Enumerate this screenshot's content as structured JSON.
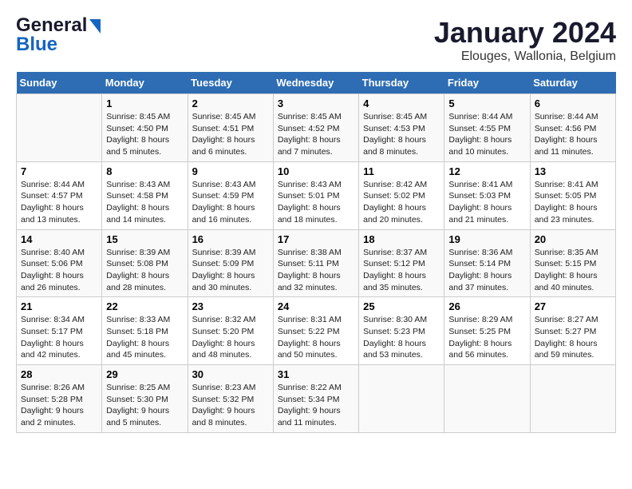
{
  "logo": {
    "general": "General",
    "blue": "Blue"
  },
  "title": "January 2024",
  "subtitle": "Elouges, Wallonia, Belgium",
  "days_of_week": [
    "Sunday",
    "Monday",
    "Tuesday",
    "Wednesday",
    "Thursday",
    "Friday",
    "Saturday"
  ],
  "weeks": [
    [
      {
        "day": "",
        "sunrise": "",
        "sunset": "",
        "daylight": ""
      },
      {
        "day": "1",
        "sunrise": "Sunrise: 8:45 AM",
        "sunset": "Sunset: 4:50 PM",
        "daylight": "Daylight: 8 hours and 5 minutes."
      },
      {
        "day": "2",
        "sunrise": "Sunrise: 8:45 AM",
        "sunset": "Sunset: 4:51 PM",
        "daylight": "Daylight: 8 hours and 6 minutes."
      },
      {
        "day": "3",
        "sunrise": "Sunrise: 8:45 AM",
        "sunset": "Sunset: 4:52 PM",
        "daylight": "Daylight: 8 hours and 7 minutes."
      },
      {
        "day": "4",
        "sunrise": "Sunrise: 8:45 AM",
        "sunset": "Sunset: 4:53 PM",
        "daylight": "Daylight: 8 hours and 8 minutes."
      },
      {
        "day": "5",
        "sunrise": "Sunrise: 8:44 AM",
        "sunset": "Sunset: 4:55 PM",
        "daylight": "Daylight: 8 hours and 10 minutes."
      },
      {
        "day": "6",
        "sunrise": "Sunrise: 8:44 AM",
        "sunset": "Sunset: 4:56 PM",
        "daylight": "Daylight: 8 hours and 11 minutes."
      }
    ],
    [
      {
        "day": "7",
        "sunrise": "Sunrise: 8:44 AM",
        "sunset": "Sunset: 4:57 PM",
        "daylight": "Daylight: 8 hours and 13 minutes."
      },
      {
        "day": "8",
        "sunrise": "Sunrise: 8:43 AM",
        "sunset": "Sunset: 4:58 PM",
        "daylight": "Daylight: 8 hours and 14 minutes."
      },
      {
        "day": "9",
        "sunrise": "Sunrise: 8:43 AM",
        "sunset": "Sunset: 4:59 PM",
        "daylight": "Daylight: 8 hours and 16 minutes."
      },
      {
        "day": "10",
        "sunrise": "Sunrise: 8:43 AM",
        "sunset": "Sunset: 5:01 PM",
        "daylight": "Daylight: 8 hours and 18 minutes."
      },
      {
        "day": "11",
        "sunrise": "Sunrise: 8:42 AM",
        "sunset": "Sunset: 5:02 PM",
        "daylight": "Daylight: 8 hours and 20 minutes."
      },
      {
        "day": "12",
        "sunrise": "Sunrise: 8:41 AM",
        "sunset": "Sunset: 5:03 PM",
        "daylight": "Daylight: 8 hours and 21 minutes."
      },
      {
        "day": "13",
        "sunrise": "Sunrise: 8:41 AM",
        "sunset": "Sunset: 5:05 PM",
        "daylight": "Daylight: 8 hours and 23 minutes."
      }
    ],
    [
      {
        "day": "14",
        "sunrise": "Sunrise: 8:40 AM",
        "sunset": "Sunset: 5:06 PM",
        "daylight": "Daylight: 8 hours and 26 minutes."
      },
      {
        "day": "15",
        "sunrise": "Sunrise: 8:39 AM",
        "sunset": "Sunset: 5:08 PM",
        "daylight": "Daylight: 8 hours and 28 minutes."
      },
      {
        "day": "16",
        "sunrise": "Sunrise: 8:39 AM",
        "sunset": "Sunset: 5:09 PM",
        "daylight": "Daylight: 8 hours and 30 minutes."
      },
      {
        "day": "17",
        "sunrise": "Sunrise: 8:38 AM",
        "sunset": "Sunset: 5:11 PM",
        "daylight": "Daylight: 8 hours and 32 minutes."
      },
      {
        "day": "18",
        "sunrise": "Sunrise: 8:37 AM",
        "sunset": "Sunset: 5:12 PM",
        "daylight": "Daylight: 8 hours and 35 minutes."
      },
      {
        "day": "19",
        "sunrise": "Sunrise: 8:36 AM",
        "sunset": "Sunset: 5:14 PM",
        "daylight": "Daylight: 8 hours and 37 minutes."
      },
      {
        "day": "20",
        "sunrise": "Sunrise: 8:35 AM",
        "sunset": "Sunset: 5:15 PM",
        "daylight": "Daylight: 8 hours and 40 minutes."
      }
    ],
    [
      {
        "day": "21",
        "sunrise": "Sunrise: 8:34 AM",
        "sunset": "Sunset: 5:17 PM",
        "daylight": "Daylight: 8 hours and 42 minutes."
      },
      {
        "day": "22",
        "sunrise": "Sunrise: 8:33 AM",
        "sunset": "Sunset: 5:18 PM",
        "daylight": "Daylight: 8 hours and 45 minutes."
      },
      {
        "day": "23",
        "sunrise": "Sunrise: 8:32 AM",
        "sunset": "Sunset: 5:20 PM",
        "daylight": "Daylight: 8 hours and 48 minutes."
      },
      {
        "day": "24",
        "sunrise": "Sunrise: 8:31 AM",
        "sunset": "Sunset: 5:22 PM",
        "daylight": "Daylight: 8 hours and 50 minutes."
      },
      {
        "day": "25",
        "sunrise": "Sunrise: 8:30 AM",
        "sunset": "Sunset: 5:23 PM",
        "daylight": "Daylight: 8 hours and 53 minutes."
      },
      {
        "day": "26",
        "sunrise": "Sunrise: 8:29 AM",
        "sunset": "Sunset: 5:25 PM",
        "daylight": "Daylight: 8 hours and 56 minutes."
      },
      {
        "day": "27",
        "sunrise": "Sunrise: 8:27 AM",
        "sunset": "Sunset: 5:27 PM",
        "daylight": "Daylight: 8 hours and 59 minutes."
      }
    ],
    [
      {
        "day": "28",
        "sunrise": "Sunrise: 8:26 AM",
        "sunset": "Sunset: 5:28 PM",
        "daylight": "Daylight: 9 hours and 2 minutes."
      },
      {
        "day": "29",
        "sunrise": "Sunrise: 8:25 AM",
        "sunset": "Sunset: 5:30 PM",
        "daylight": "Daylight: 9 hours and 5 minutes."
      },
      {
        "day": "30",
        "sunrise": "Sunrise: 8:23 AM",
        "sunset": "Sunset: 5:32 PM",
        "daylight": "Daylight: 9 hours and 8 minutes."
      },
      {
        "day": "31",
        "sunrise": "Sunrise: 8:22 AM",
        "sunset": "Sunset: 5:34 PM",
        "daylight": "Daylight: 9 hours and 11 minutes."
      },
      {
        "day": "",
        "sunrise": "",
        "sunset": "",
        "daylight": ""
      },
      {
        "day": "",
        "sunrise": "",
        "sunset": "",
        "daylight": ""
      },
      {
        "day": "",
        "sunrise": "",
        "sunset": "",
        "daylight": ""
      }
    ]
  ]
}
